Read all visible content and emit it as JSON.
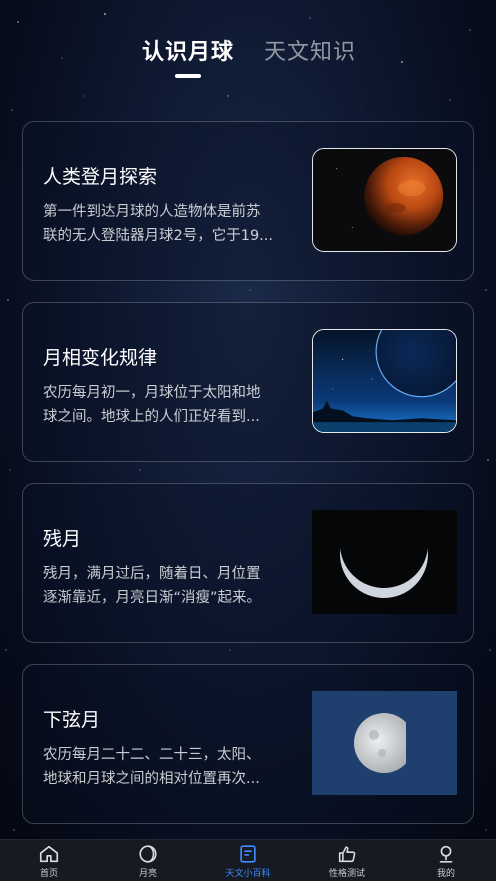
{
  "tabs": [
    {
      "label": "认识月球",
      "active": true
    },
    {
      "label": "天文知识",
      "active": false
    }
  ],
  "cards": [
    {
      "title": "人类登月探索",
      "desc_lines": [
        "第一件到达月球的人造物体是前苏",
        "联的无人登陆器月球2号，它于19..."
      ],
      "image": "red-planet-image"
    },
    {
      "title": "月相变化规律",
      "desc_lines": [
        "农历每月初一，月球位于太阳和地",
        "球之间。地球上的人们正好看到..."
      ],
      "image": "blue-moon-horizon-image"
    },
    {
      "title": "残月",
      "desc_lines": [
        "残月，满月过后，随着日、月位置",
        "逐渐靠近，月亮日渐“消瘦”起来。"
      ],
      "image": "crescent-moon-image"
    },
    {
      "title": "下弦月",
      "desc_lines": [
        "农历每月二十二、二十三，太阳、",
        "地球和月球之间的相对位置再次..."
      ],
      "image": "half-moon-image"
    }
  ],
  "navbar": {
    "items": [
      {
        "label": "首页",
        "icon": "home-icon",
        "active": false
      },
      {
        "label": "月亮",
        "icon": "moon-icon",
        "active": false
      },
      {
        "label": "天文小百科",
        "icon": "encyclopedia-icon",
        "active": true
      },
      {
        "label": "性格测试",
        "icon": "thumbs-up-icon",
        "active": false
      },
      {
        "label": "我的",
        "icon": "profile-icon",
        "active": false
      }
    ]
  },
  "colors": {
    "active_nav": "#3d8bff",
    "background": "#0e1830",
    "navbar_bg": "#161a22"
  }
}
